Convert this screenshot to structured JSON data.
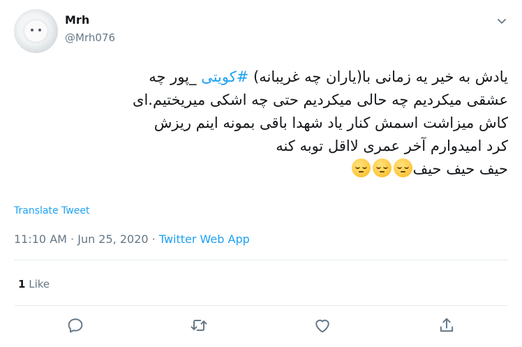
{
  "author": {
    "display_name": "Mrh",
    "handle": "@Mrh076"
  },
  "tweet": {
    "line1_before": "یادش به خیر یه زمانی با(یاران چه غریبانه) ",
    "hashtag": "#کویتی",
    "line1_after": " _پور چه",
    "line2": "عشقی میکردیم چه حالی میکردیم حتی چه اشکی میریختیم.ای",
    "line3": "کاش میزاشت اسمش کنار یاد شهدا باقی بمونه اینم ریزش",
    "line4": "کرد امیدوارم آخر عمری لااقل توبه کنه",
    "line5": "حیف حیف حیف",
    "emojis": [
      "pensive-face",
      "pensive-face",
      "pensive-face"
    ]
  },
  "translate_label": "Translate Tweet",
  "meta": {
    "time": "11:10 AM",
    "separator": " · ",
    "date": "Jun 25, 2020",
    "source": "Twitter Web App"
  },
  "likes": {
    "count": "1",
    "label": " Like"
  },
  "icons": {
    "menu": "chevron-down-icon",
    "reply": "reply-icon",
    "retweet": "retweet-icon",
    "like": "heart-icon",
    "share": "share-icon"
  },
  "colors": {
    "accent": "#1da1f2",
    "text": "#14171a",
    "muted": "#657786",
    "border": "#e6ecf0"
  }
}
